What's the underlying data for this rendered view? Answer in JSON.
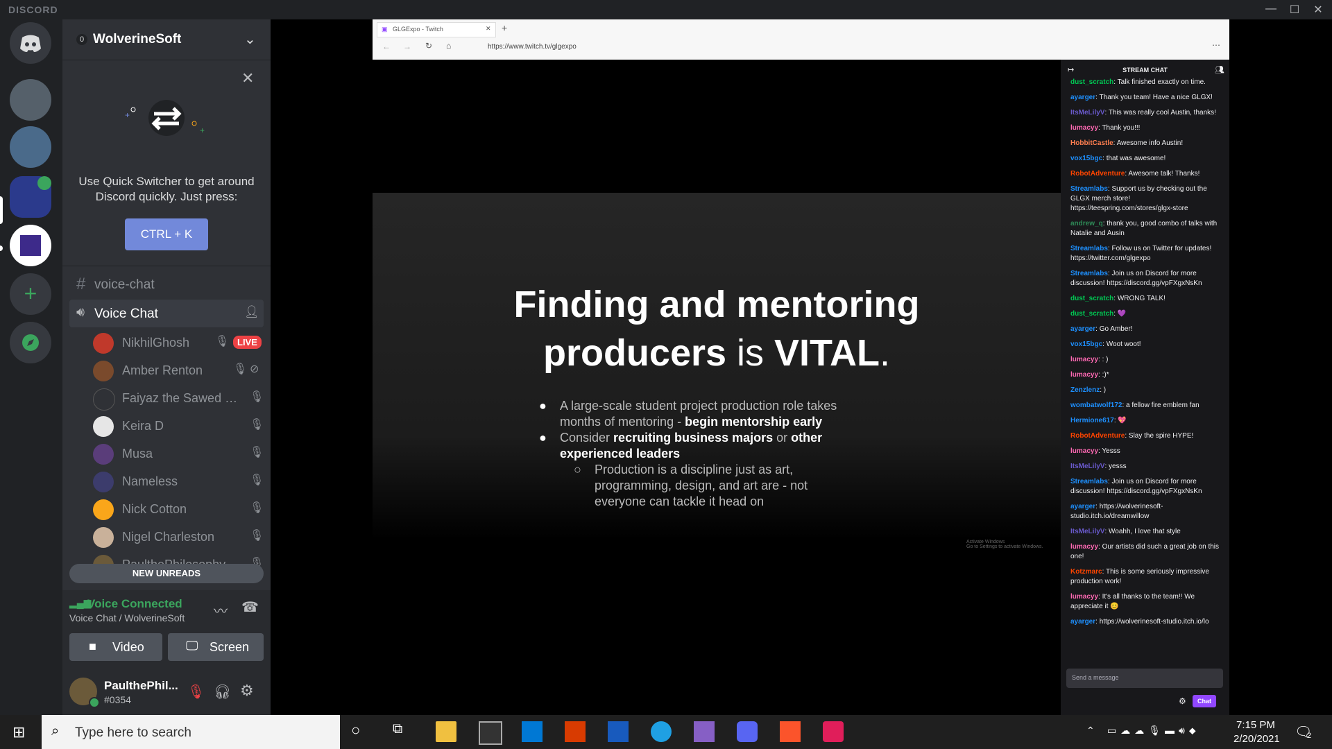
{
  "window": {
    "app_name": "DISCORD"
  },
  "guild": {
    "name": "WolverineSoft",
    "boost_count": "0"
  },
  "quick_switcher": {
    "text_line1": "Use Quick Switcher to get around",
    "text_line2": "Discord quickly. Just press:",
    "shortcut": "CTRL + K"
  },
  "channels": {
    "text_channel": "voice-chat",
    "voice_channel": "Voice Chat"
  },
  "members": [
    {
      "name": "NikhilGhosh",
      "live": "LIVE",
      "color": "#c0392b"
    },
    {
      "name": "Amber Renton",
      "color": "#7a4a2c"
    },
    {
      "name": "Faiyaz the Sawed of...",
      "color": "#2f3136"
    },
    {
      "name": "Keira D",
      "color": "#e6e6e6"
    },
    {
      "name": "Musa",
      "color": "#5a3d7a"
    },
    {
      "name": "Nameless",
      "color": "#3c3c6c"
    },
    {
      "name": "Nick Cotton",
      "color": "#faa61a"
    },
    {
      "name": "Nigel Charleston",
      "color": "#c9b19a"
    },
    {
      "name": "PaulthePhilosophy...",
      "color": "#6b5a3a"
    }
  ],
  "new_unreads": "NEW UNREADS",
  "voice_panel": {
    "status": "Voice Connected",
    "location": "Voice Chat / WolverineSoft",
    "video_label": "Video",
    "screen_label": "Screen"
  },
  "user": {
    "name": "PaulthePhil...",
    "tag": "#0354"
  },
  "browser": {
    "tab_title": "GLGExpo - Twitch",
    "url": "https://www.twitch.tv/glgexpo"
  },
  "slide": {
    "title_line1": "Finding and mentoring",
    "title_line2a": "producers ",
    "title_line2b": "is",
    "title_line2c": " VITAL",
    "bullet1a": "A large-scale student project production role takes months of mentoring - ",
    "bullet1b": "begin mentorship early",
    "bullet2a": "Consider ",
    "bullet2b": "recruiting business majors",
    "bullet2c": " or ",
    "bullet2d": "other experienced leaders",
    "sub_bullet": "Production is a discipline just as art, programming, design, and art are - not everyone can tackle it head on",
    "watermark1": "Activate Windows",
    "watermark2": "Go to Settings to activate Windows."
  },
  "stream_chat": {
    "header": "STREAM CHAT",
    "messages": [
      {
        "user": "dust_scratch",
        "text": "Talk finished exactly on time.",
        "color": "#00c853"
      },
      {
        "user": "ayarger",
        "text": "Thank you team! Have a nice GLGX!",
        "color": "#1e90ff"
      },
      {
        "user": "ItsMeLilyV",
        "text": "This was really cool Austin, thanks!",
        "color": "#6a5acd"
      },
      {
        "user": "lumacyy",
        "text": "Thank you!!!",
        "color": "#ff69b4"
      },
      {
        "user": "HobbitCastle",
        "text": "Awesome info Austin!",
        "color": "#ff7f50"
      },
      {
        "user": "vox15bgc",
        "text": "that was awesome!",
        "color": "#1e90ff"
      },
      {
        "user": "RobotAdventure",
        "text": "Awesome talk! Thanks!",
        "color": "#ff4500"
      },
      {
        "user": "Streamlabs",
        "text": "Support us by checking out the GLGX merch store! https://teespring.com/stores/glgx-store",
        "color": "#1e90ff"
      },
      {
        "user": "andrew_q",
        "text": "thank you, good combo of talks with Natalie and Ausin",
        "color": "#2e8b57"
      },
      {
        "user": "Streamlabs",
        "text": "Follow us on Twitter for updates! https://twitter.com/glgexpo",
        "color": "#1e90ff"
      },
      {
        "user": "Streamlabs",
        "text": "Join us on Discord for more discussion! https://discord.gg/vpFXgxNsKn",
        "color": "#1e90ff"
      },
      {
        "user": "dust_scratch",
        "text": "WRONG TALK!",
        "color": "#00c853"
      },
      {
        "user": "dust_scratch",
        "text": "💜",
        "color": "#00c853"
      },
      {
        "user": "ayarger",
        "text": "Go Amber!",
        "color": "#1e90ff"
      },
      {
        "user": "vox15bgc",
        "text": "Woot woot!",
        "color": "#1e90ff"
      },
      {
        "user": "lumacyy",
        "text": ": )",
        "color": "#ff69b4"
      },
      {
        "user": "lumacyy",
        "text": ":)*",
        "color": "#ff69b4"
      },
      {
        "user": "Zenzlenz",
        "text": ")",
        "color": "#1e90ff"
      },
      {
        "user": "wombatwolf172",
        "text": "a fellow fire emblem fan",
        "color": "#1e90ff"
      },
      {
        "user": "Hermione617",
        "text": "💖",
        "color": "#1e90ff"
      },
      {
        "user": "RobotAdventure",
        "text": "Slay the spire HYPE!",
        "color": "#ff4500"
      },
      {
        "user": "lumacyy",
        "text": "Yesss",
        "color": "#ff69b4"
      },
      {
        "user": "ItsMeLilyV",
        "text": "yesss",
        "color": "#6a5acd"
      },
      {
        "user": "Streamlabs",
        "text": "Join us on Discord for more discussion! https://discord.gg/vpFXgxNsKn",
        "color": "#1e90ff"
      },
      {
        "user": "ayarger",
        "text": "https://wolverinesoft-studio.itch.io/dreamwillow",
        "color": "#1e90ff"
      },
      {
        "user": "ItsMeLilyV",
        "text": "Woahh, I love that style",
        "color": "#6a5acd"
      },
      {
        "user": "lumacyy",
        "text": "Our artists did such a great job on this one!",
        "color": "#ff69b4"
      },
      {
        "user": "Kotzmarc",
        "text": "This is some seriously impressive production work!",
        "color": "#ff4500"
      },
      {
        "user": "lumacyy",
        "text": "It's all thanks to the team!! We appreciate it 😊",
        "color": "#ff69b4"
      },
      {
        "user": "ayarger",
        "text": "https://wolverinesoft-studio.itch.io/lo",
        "color": "#1e90ff"
      }
    ],
    "input_placeholder": "Send a message",
    "chat_button": "Chat"
  },
  "taskbar": {
    "search_placeholder": "Type here to search",
    "time": "7:15 PM",
    "date": "2/20/2021",
    "notification_count": "2"
  },
  "colors": {
    "accent": "#7289da",
    "live_red": "#ed4245",
    "voice_green": "#3ba55d",
    "twitch_purple": "#9147ff"
  }
}
